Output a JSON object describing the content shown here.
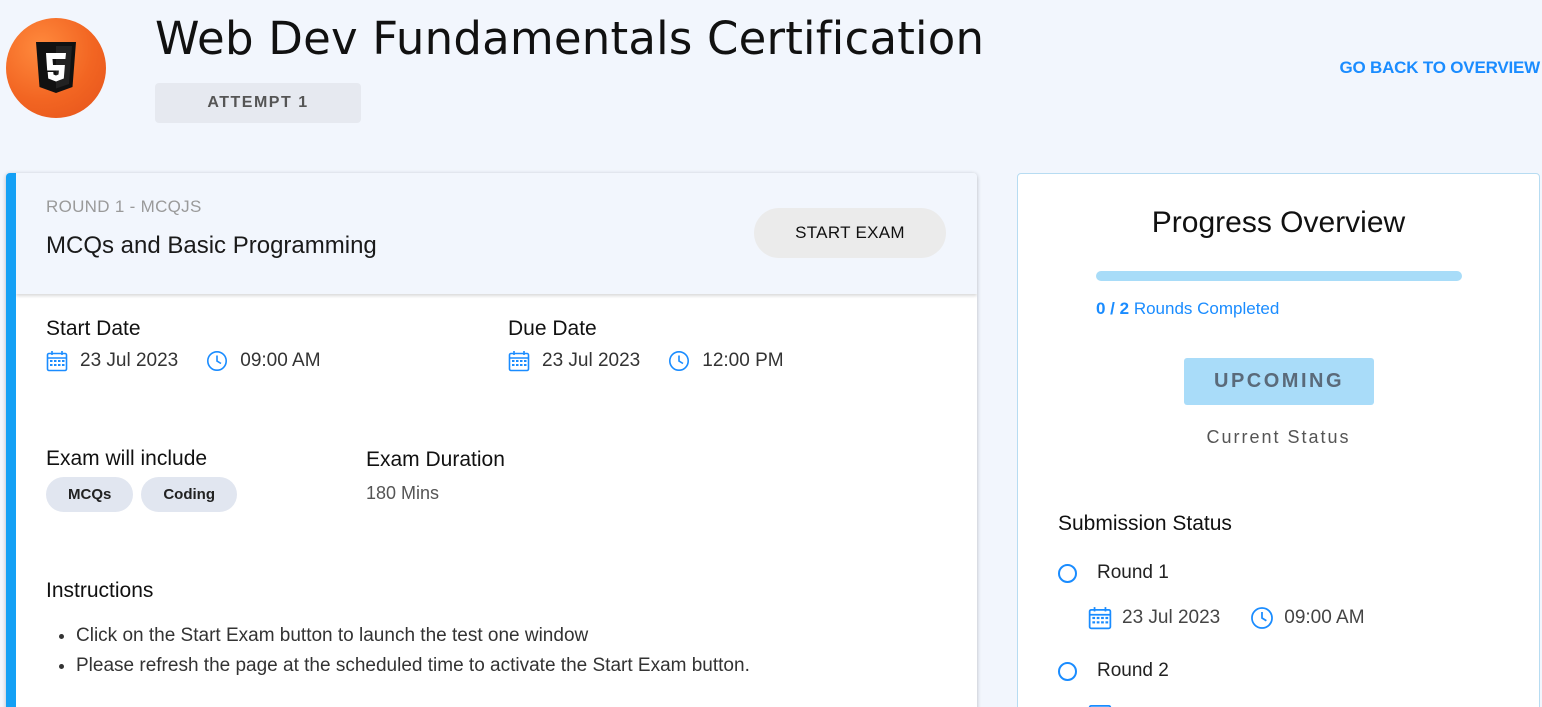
{
  "header": {
    "logo_icon": "html5-icon",
    "title": "Web Dev Fundamentals Certification",
    "attempt": "ATTEMPT 1",
    "back_link": "GO BACK TO OVERVIEW"
  },
  "round": {
    "code": "ROUND 1 - MCQJS",
    "name": "MCQs and Basic Programming",
    "start_button": "START EXAM",
    "start_date_label": "Start Date",
    "start_date": "23 Jul 2023",
    "start_time": "09:00 AM",
    "due_date_label": "Due Date",
    "due_date": "23 Jul 2023",
    "due_time": "12:00 PM",
    "include_label": "Exam will include",
    "includes": [
      "MCQs",
      "Coding"
    ],
    "duration_label": "Exam Duration",
    "duration": "180  Mins",
    "instructions_label": "Instructions",
    "instructions": [
      "Click on the Start Exam button to launch the test one window",
      "Please refresh the page at the scheduled time to activate the Start Exam button."
    ]
  },
  "progress": {
    "title": "Progress Overview",
    "completed": "0 / 2",
    "completed_suffix": " Rounds Completed",
    "completed_fraction": 0,
    "status": "UPCOMING",
    "status_caption": "Current Status",
    "submission_title": "Submission Status",
    "rounds": [
      {
        "label": "Round 1",
        "date": "23 Jul 2023",
        "time": "09:00 AM"
      },
      {
        "label": "Round 2"
      }
    ]
  },
  "colors": {
    "accent": "#1a8cff",
    "card_stripe": "#14a0f5",
    "badge_bg": "#a9dcf9",
    "page_bg": "#f2f6fd"
  }
}
